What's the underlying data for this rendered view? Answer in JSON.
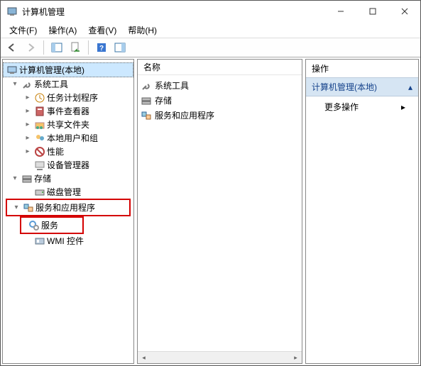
{
  "window": {
    "title": "计算机管理"
  },
  "menu": {
    "file": "文件(F)",
    "action": "操作(A)",
    "view": "查看(V)",
    "help": "帮助(H)"
  },
  "tree": {
    "root": "计算机管理(本地)",
    "systools": "系统工具",
    "scheduler": "任务计划程序",
    "eventvwr": "事件查看器",
    "shared": "共享文件夹",
    "users": "本地用户和组",
    "perf": "性能",
    "devmgr": "设备管理器",
    "storage": "存储",
    "diskmgmt": "磁盘管理",
    "services_apps": "服务和应用程序",
    "services": "服务",
    "wmi": "WMI 控件"
  },
  "mid": {
    "header": "名称",
    "items": {
      "systools": "系统工具",
      "storage": "存储",
      "services_apps": "服务和应用程序"
    }
  },
  "actions": {
    "header": "操作",
    "group": "计算机管理(本地)",
    "more": "更多操作"
  }
}
